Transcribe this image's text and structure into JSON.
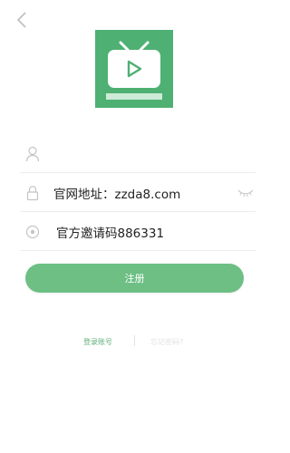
{
  "header": {
    "back_icon": "chevron-left-icon"
  },
  "logo": {
    "icon": "tv-play-icon",
    "bg_color": "#4fb073"
  },
  "form": {
    "username": {
      "icon": "user-icon",
      "value": ""
    },
    "password": {
      "icon": "lock-icon",
      "value": "官网地址：zzda8.com",
      "toggle_icon": "eye-closed-icon"
    },
    "invite": {
      "icon": "invite-code-icon",
      "value": "官方邀请码886331"
    }
  },
  "actions": {
    "register_label": "注册",
    "register_color": "#6dbf84",
    "login_link": "登录账号",
    "forgot_link": "忘记密码?"
  }
}
